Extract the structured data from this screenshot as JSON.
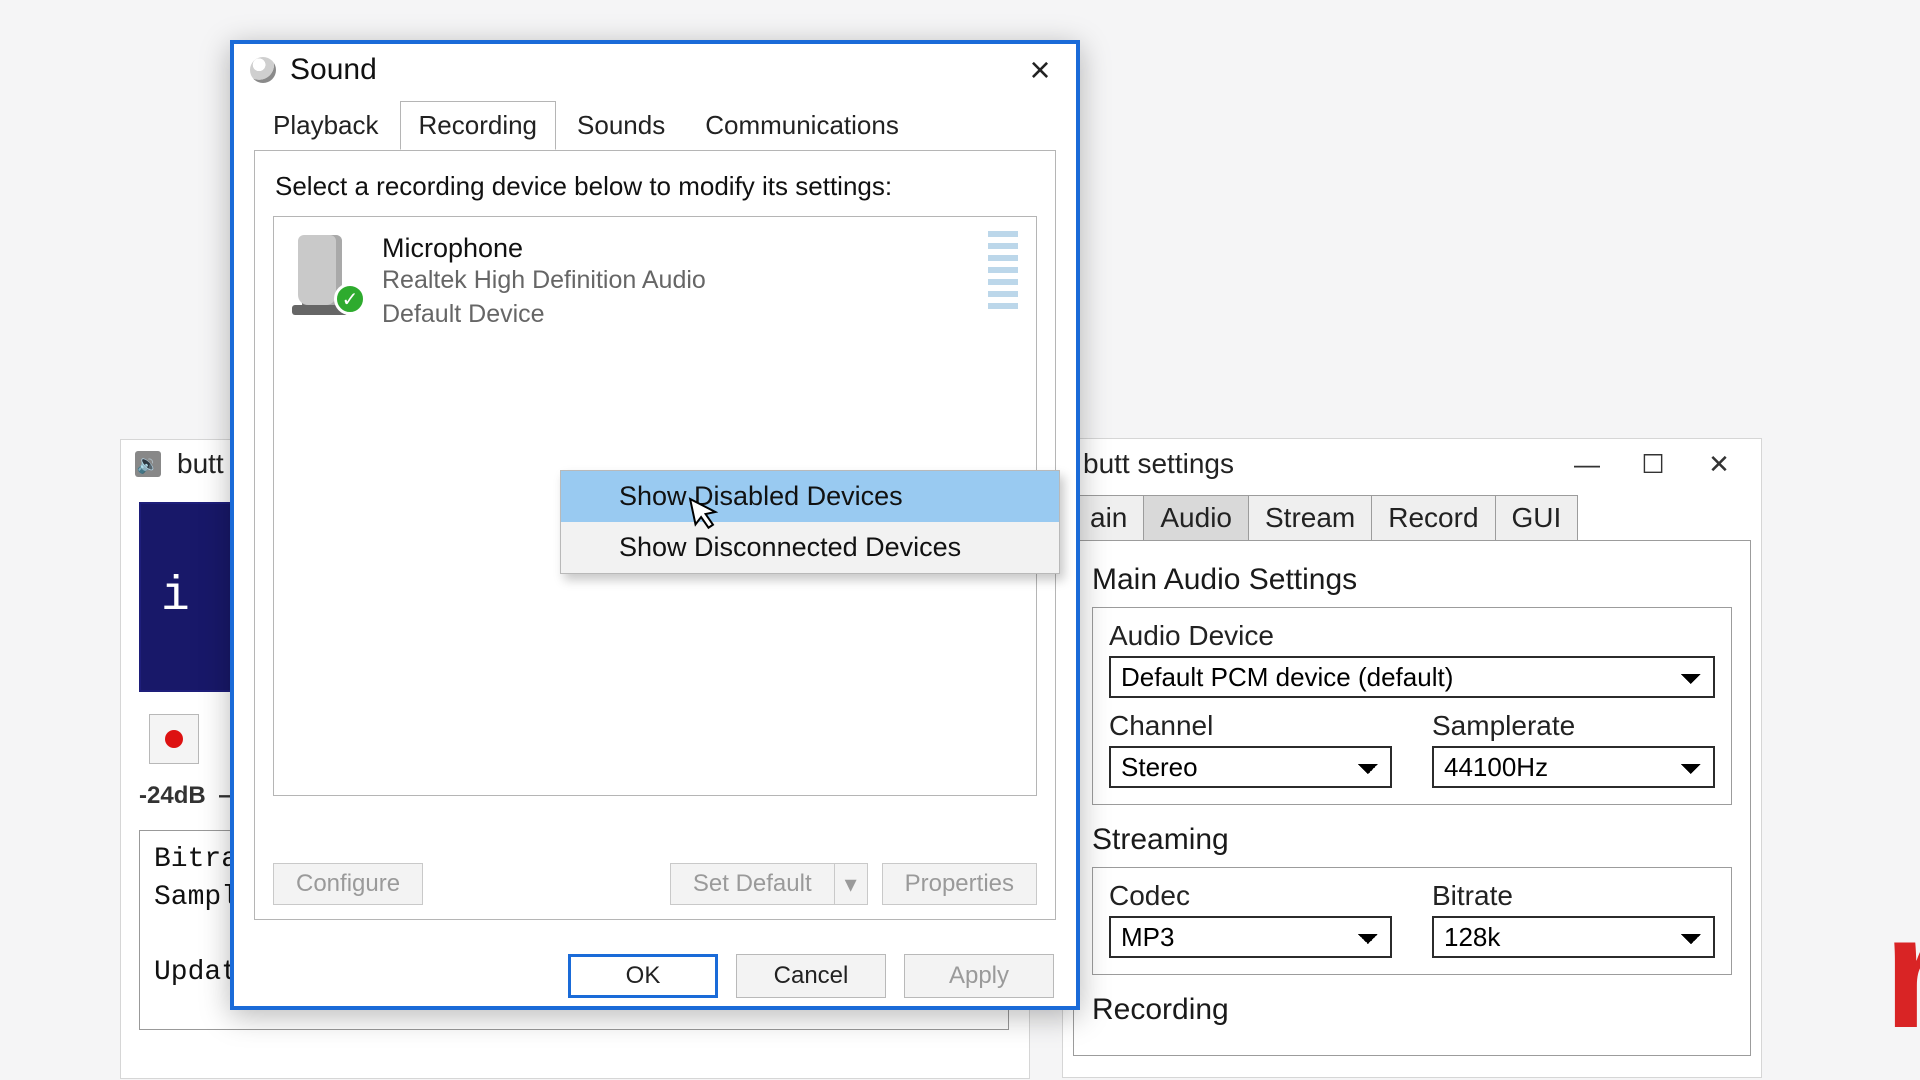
{
  "butt_main": {
    "title": "butt",
    "display_text": "i",
    "db_label": "-24dB",
    "log_lines": "Bitra\nSample\n\nUpdated songname to:"
  },
  "butt_settings": {
    "title": "butt settings",
    "tabs": {
      "t0": "ain",
      "t1": "Audio",
      "t2": "Stream",
      "t3": "Record",
      "t4": "GUI"
    },
    "section_main": "Main Audio Settings",
    "labels": {
      "audio_device": "Audio Device",
      "channel": "Channel",
      "samplerate": "Samplerate",
      "codec": "Codec",
      "bitrate": "Bitrate"
    },
    "values": {
      "audio_device": "Default PCM device (default)",
      "channel": "Stereo",
      "samplerate": "44100Hz",
      "codec": "MP3",
      "bitrate": "128k"
    },
    "section_stream": "Streaming",
    "section_record": "Recording"
  },
  "sound": {
    "title": "Sound",
    "tabs": {
      "playback": "Playback",
      "recording": "Recording",
      "sounds": "Sounds",
      "comms": "Communications"
    },
    "prompt": "Select a recording device below to modify its settings:",
    "device": {
      "name": "Microphone",
      "sub1": "Realtek High Definition Audio",
      "sub2": "Default Device"
    },
    "buttons": {
      "configure": "Configure",
      "set_default": "Set Default",
      "properties": "Properties",
      "ok": "OK",
      "cancel": "Cancel",
      "apply": "Apply"
    }
  },
  "ctx": {
    "show_disabled": "Show Disabled Devices",
    "show_disconnected": "Show Disconnected Devices"
  },
  "bg_text": "r"
}
